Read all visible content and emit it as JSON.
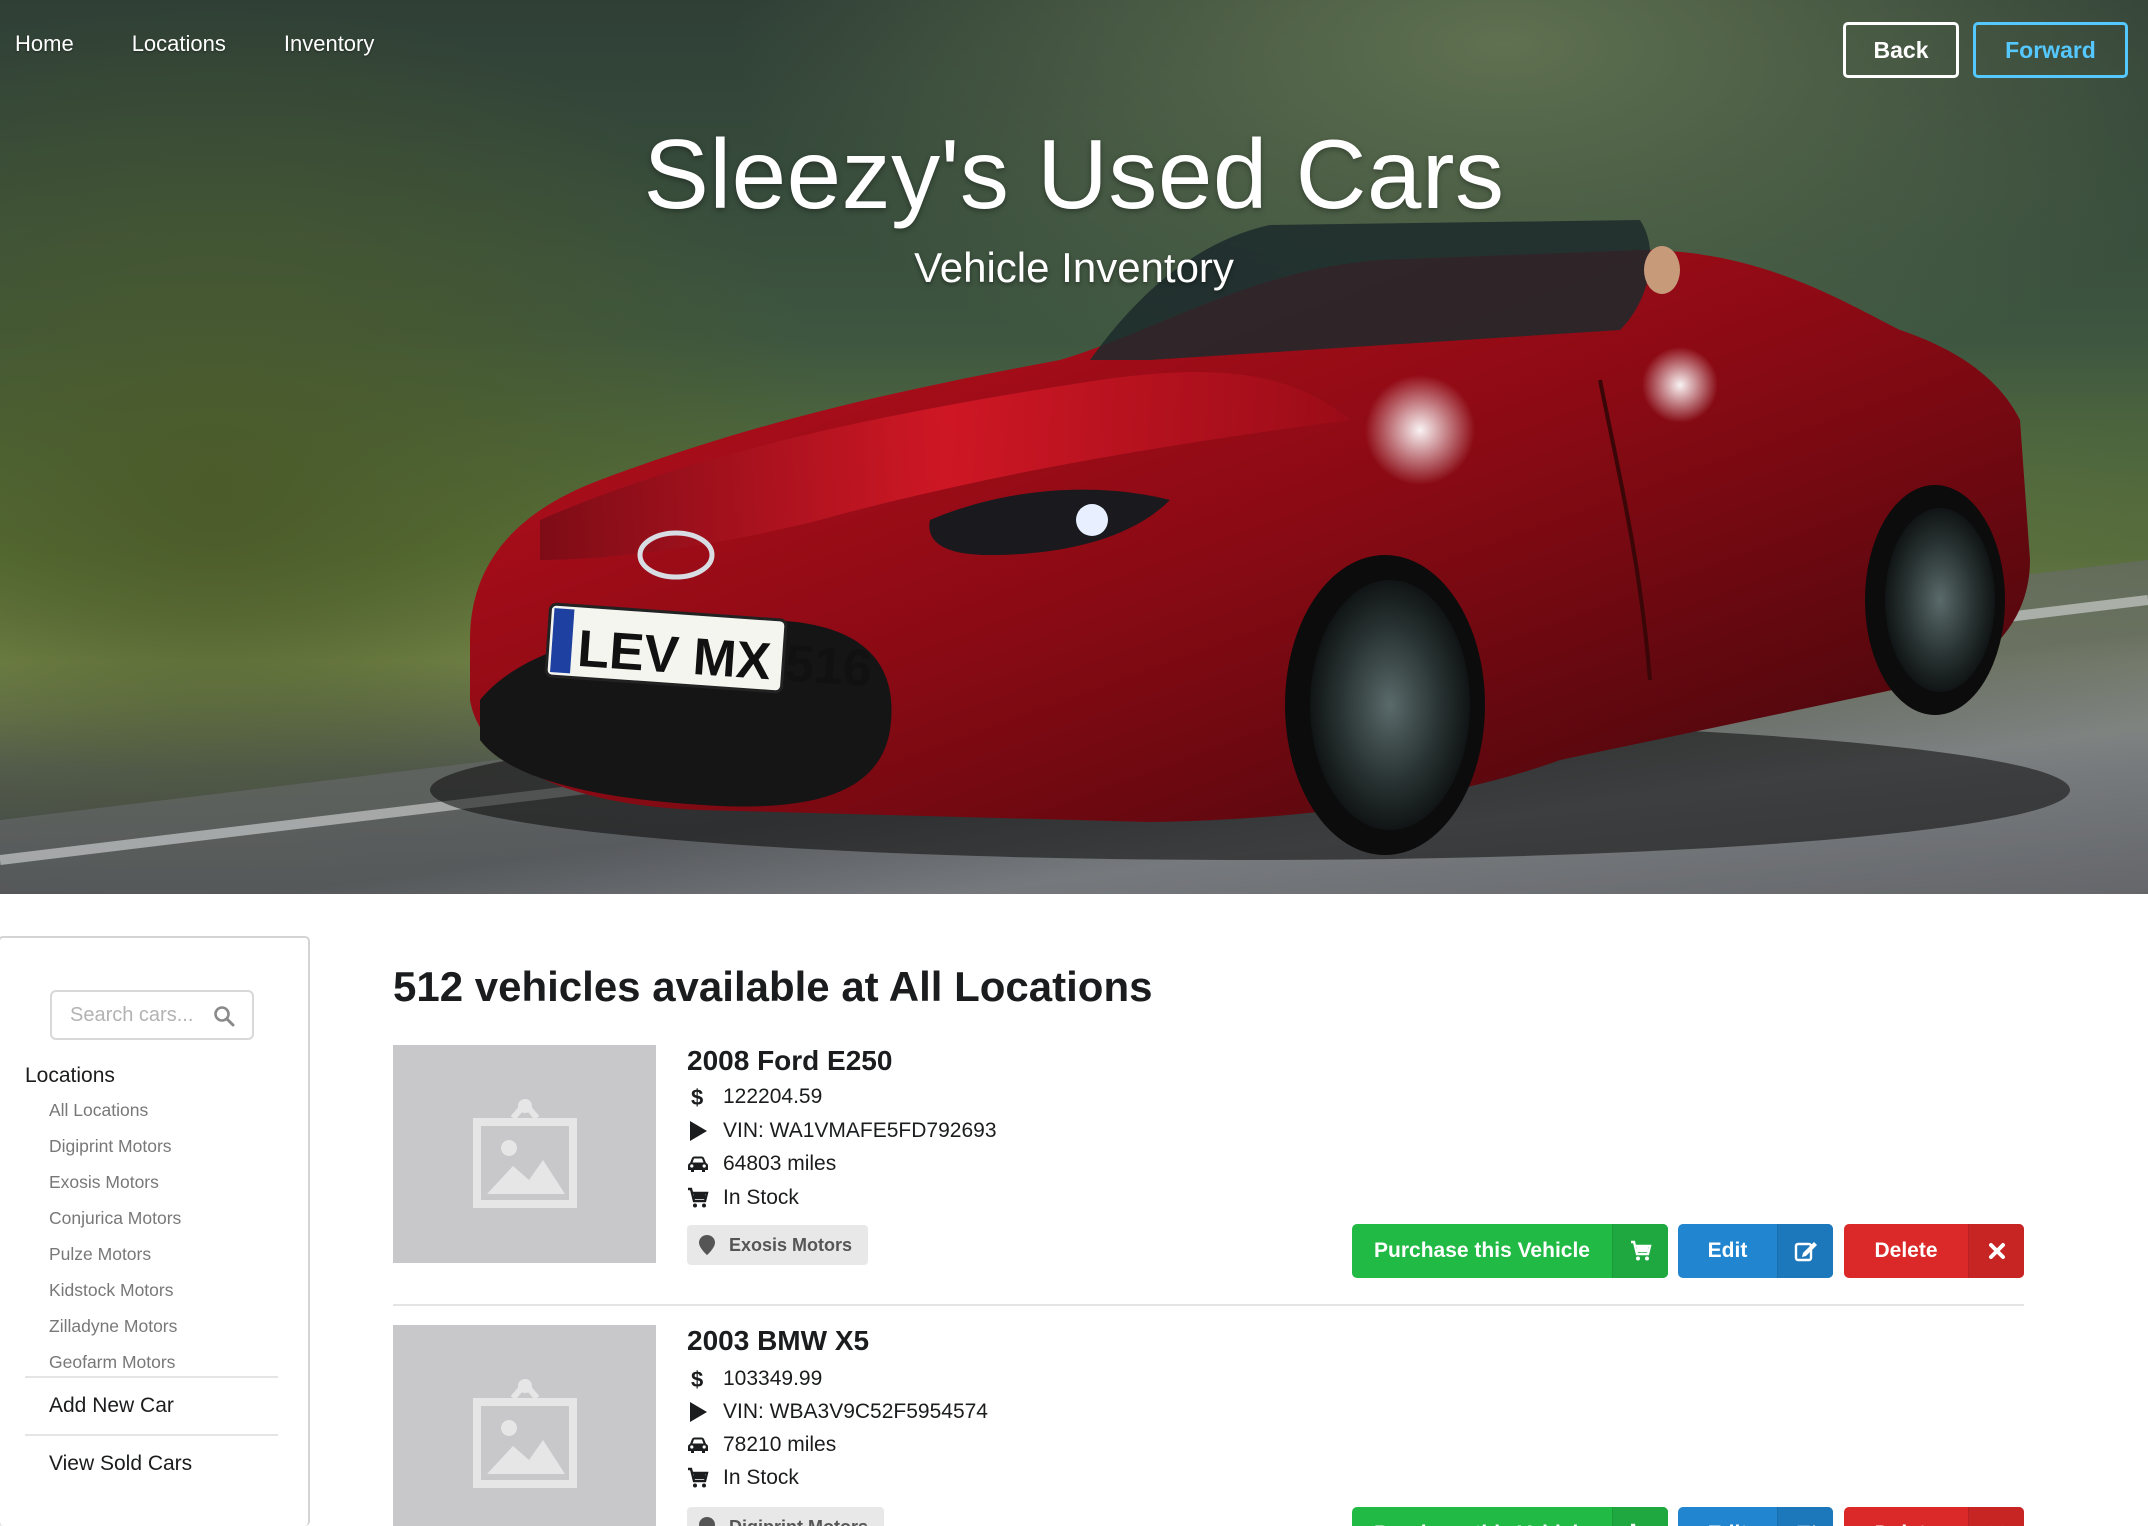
{
  "nav": {
    "links": [
      {
        "label": "Home"
      },
      {
        "label": "Locations"
      },
      {
        "label": "Inventory"
      }
    ],
    "back_label": "Back",
    "forward_label": "Forward",
    "forward_color": "#54c8ff"
  },
  "hero": {
    "title": "Sleezy's Used Cars",
    "subtitle": "Vehicle Inventory",
    "plate": "LEV MX 516"
  },
  "sidebar": {
    "search_placeholder": "Search cars...",
    "locations_heading": "Locations",
    "locations": [
      "All Locations",
      "Digiprint Motors",
      "Exosis Motors",
      "Conjurica Motors",
      "Pulze Motors",
      "Kidstock Motors",
      "Zilladyne Motors",
      "Geofarm Motors"
    ],
    "add_new_car": "Add New Car",
    "view_sold_cars": "View Sold Cars"
  },
  "main": {
    "heading": "512 vehicles available at All Locations",
    "vehicles": [
      {
        "title": "2008 Ford E250",
        "price": "122204.59",
        "vin": "VIN: WA1VMAFE5FD792693",
        "miles": "64803 miles",
        "status": "In Stock",
        "location": "Exosis Motors"
      },
      {
        "title": "2003 BMW X5",
        "price": "103349.99",
        "vin": "VIN: WBA3V9C52F5954574",
        "miles": "78210 miles",
        "status": "In Stock",
        "location": "Digiprint Motors"
      }
    ],
    "purchase_label": "Purchase this Vehicle",
    "edit_label": "Edit",
    "delete_label": "Delete"
  },
  "colors": {
    "green": "#21ba45",
    "blue": "#2185d0",
    "red": "#db2828"
  }
}
